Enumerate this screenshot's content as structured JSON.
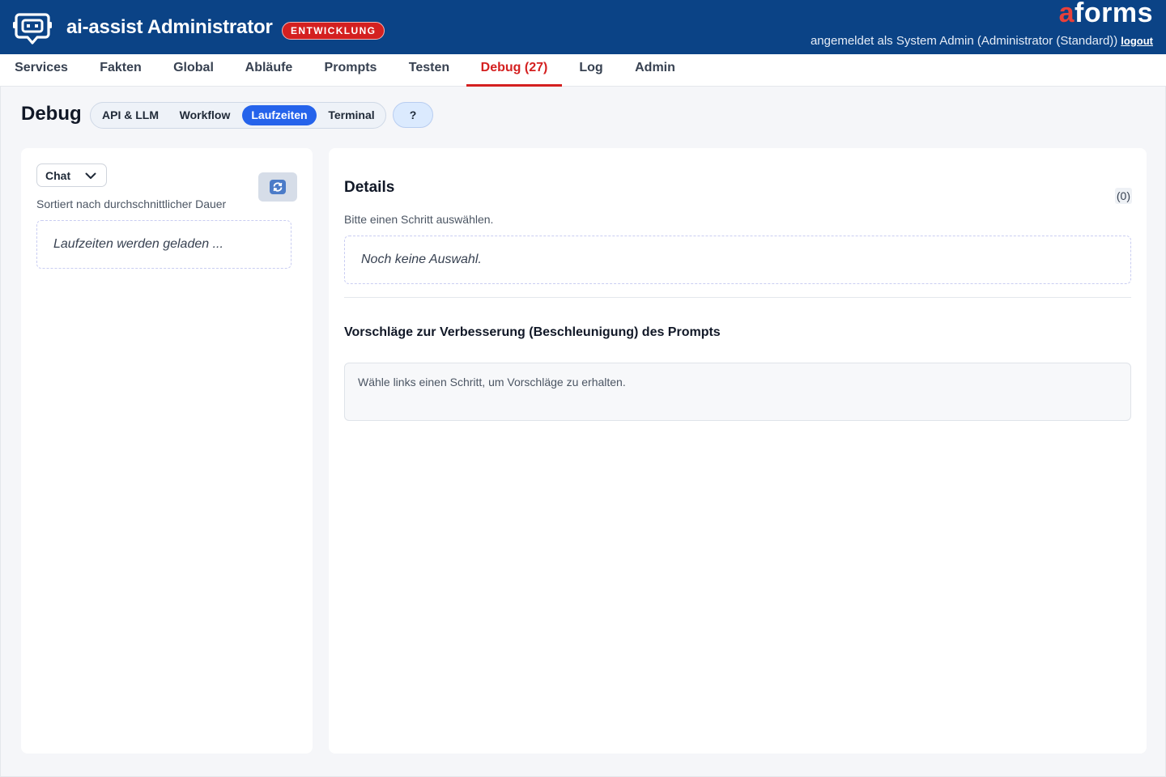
{
  "header": {
    "app_title": "ai-assist Administrator",
    "env_badge": "ENTWICKLUNG",
    "brand_a": "a",
    "brand_rest": "forms",
    "user_text": "angemeldet als System Admin (Administrator (Standard))",
    "logout": "logout",
    "logo_icon": "robot-chat-icon"
  },
  "nav": {
    "items": [
      {
        "label": "Services"
      },
      {
        "label": "Fakten"
      },
      {
        "label": "Global"
      },
      {
        "label": "Abläufe"
      },
      {
        "label": "Prompts"
      },
      {
        "label": "Testen"
      },
      {
        "label": "Debug (27)"
      },
      {
        "label": "Log"
      },
      {
        "label": "Admin"
      }
    ],
    "active": "Debug (27)"
  },
  "debug": {
    "title": "Debug",
    "tabs": [
      {
        "label": "API & LLM"
      },
      {
        "label": "Workflow"
      },
      {
        "label": "Laufzeiten"
      },
      {
        "label": "Terminal"
      }
    ],
    "active_tab": "Laufzeiten",
    "help": "?"
  },
  "left_panel": {
    "select_value": "Chat",
    "sort_caption": "Sortiert nach durchschnittlicher Dauer",
    "loading_text": "Laufzeiten werden geladen ...",
    "refresh_icon": "refresh-icon"
  },
  "right_panel": {
    "details_title": "Details",
    "count": "(0)",
    "hint": "Bitte einen Schritt auswählen.",
    "no_selection": "Noch keine Auswahl.",
    "suggest_title": "Vorschläge zur Verbesserung (Beschleunigung) des Prompts",
    "suggest_placeholder": "Wähle links einen Schritt, um Vorschläge zu erhalten."
  },
  "colors": {
    "header_bg": "#0b4386",
    "accent_red": "#d42020",
    "active_tab_blue": "#2563eb"
  }
}
